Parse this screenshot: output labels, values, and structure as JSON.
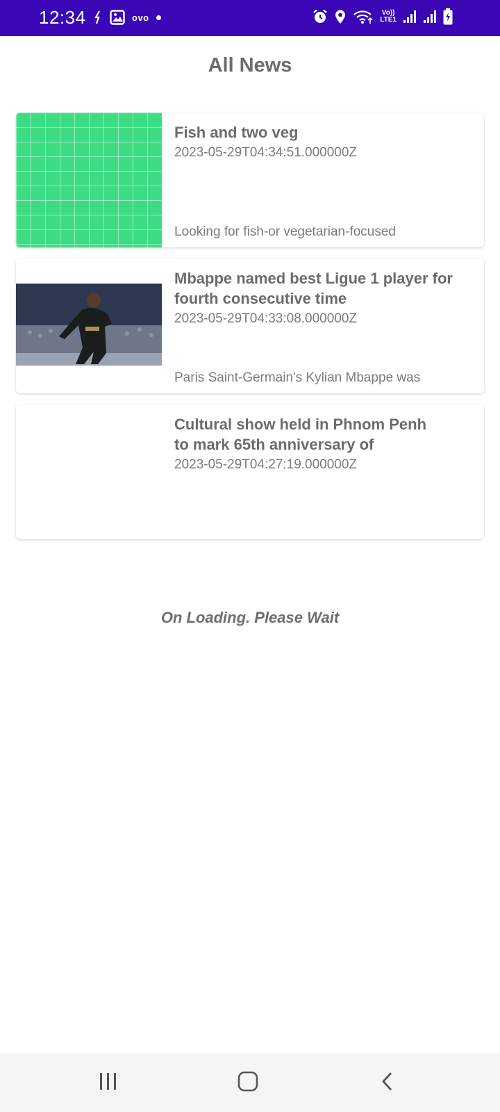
{
  "status_bar": {
    "time": "12:34",
    "left_icons": [
      "sync-icon",
      "gallery-icon",
      "ovo-app-icon",
      "dot-icon"
    ],
    "ovo_label": "ovo",
    "right_icons": [
      "alarm-icon",
      "location-icon",
      "wifi-icon",
      "volte-icon",
      "signal-icon-1",
      "signal-icon-2",
      "battery-icon"
    ],
    "volte_label_top": "Vo))",
    "volte_label_bottom": "LTE1",
    "background": "#3a06b6"
  },
  "header": {
    "title": "All News"
  },
  "news": [
    {
      "title": "Fish and two veg",
      "date": "2023-05-29T04:34:51.000000Z",
      "description": "Looking for fish-or vegetarian-focused",
      "thumbnail": "placeholder-grid",
      "thumbnail_color": "#3ddc84"
    },
    {
      "title": "Mbappe named best Ligue 1 player for fourth consecutive time",
      "date": "2023-05-29T04:33:08.000000Z",
      "description": "Paris Saint-Germain's Kylian Mbappe was",
      "thumbnail": "photo"
    },
    {
      "title": "Cultural show held in Phnom Penh to mark 65th anniversary of",
      "date": "2023-05-29T04:27:19.000000Z",
      "description": "",
      "thumbnail": "empty"
    }
  ],
  "loading_text": "On Loading. Please Wait",
  "nav_bar": {
    "buttons": [
      "recent-apps-icon",
      "home-icon",
      "back-icon"
    ]
  }
}
